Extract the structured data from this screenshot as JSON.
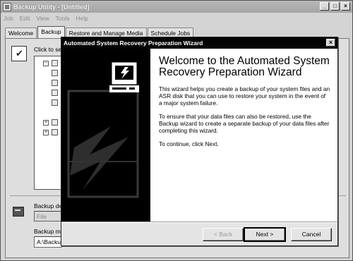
{
  "app": {
    "title": "Backup Utility - [Untitled]",
    "menu": [
      "Job",
      "Edit",
      "View",
      "Tools",
      "Help"
    ],
    "caption_buttons": {
      "minimize": "_",
      "maximize": "□",
      "close": "×"
    },
    "tabs": [
      "Welcome",
      "Backup",
      "Restore and Manage Media",
      "Schedule Jobs"
    ],
    "active_tab": "Backup",
    "panel_hint": "Click to se",
    "backup_dest_label": "Backup de",
    "backup_dest_value": "File",
    "backup_media_label": "Backup me",
    "backup_media_value": "A:\\Backu"
  },
  "wizard": {
    "title": "Automated System Recovery Preparation Wizard",
    "close_label": "×",
    "heading": "Welcome to the Automated System Recovery Preparation Wizard",
    "paragraphs": [
      "This wizard helps you create a backup of your system files and an ASR disk that you can use to restore your system in the event of a major system failure.",
      "To ensure that your data files can also be restored, use the Backup wizard to create a separate backup of your data files after completing this wizard.",
      "To continue, click Next."
    ],
    "buttons": {
      "back": "< Back",
      "next": "Next >",
      "cancel": "Cancel"
    }
  },
  "icons": {
    "side_graphic": "computer-lightning-icon",
    "panel": "checklist-icon",
    "backup": "backup-drive-icon"
  }
}
